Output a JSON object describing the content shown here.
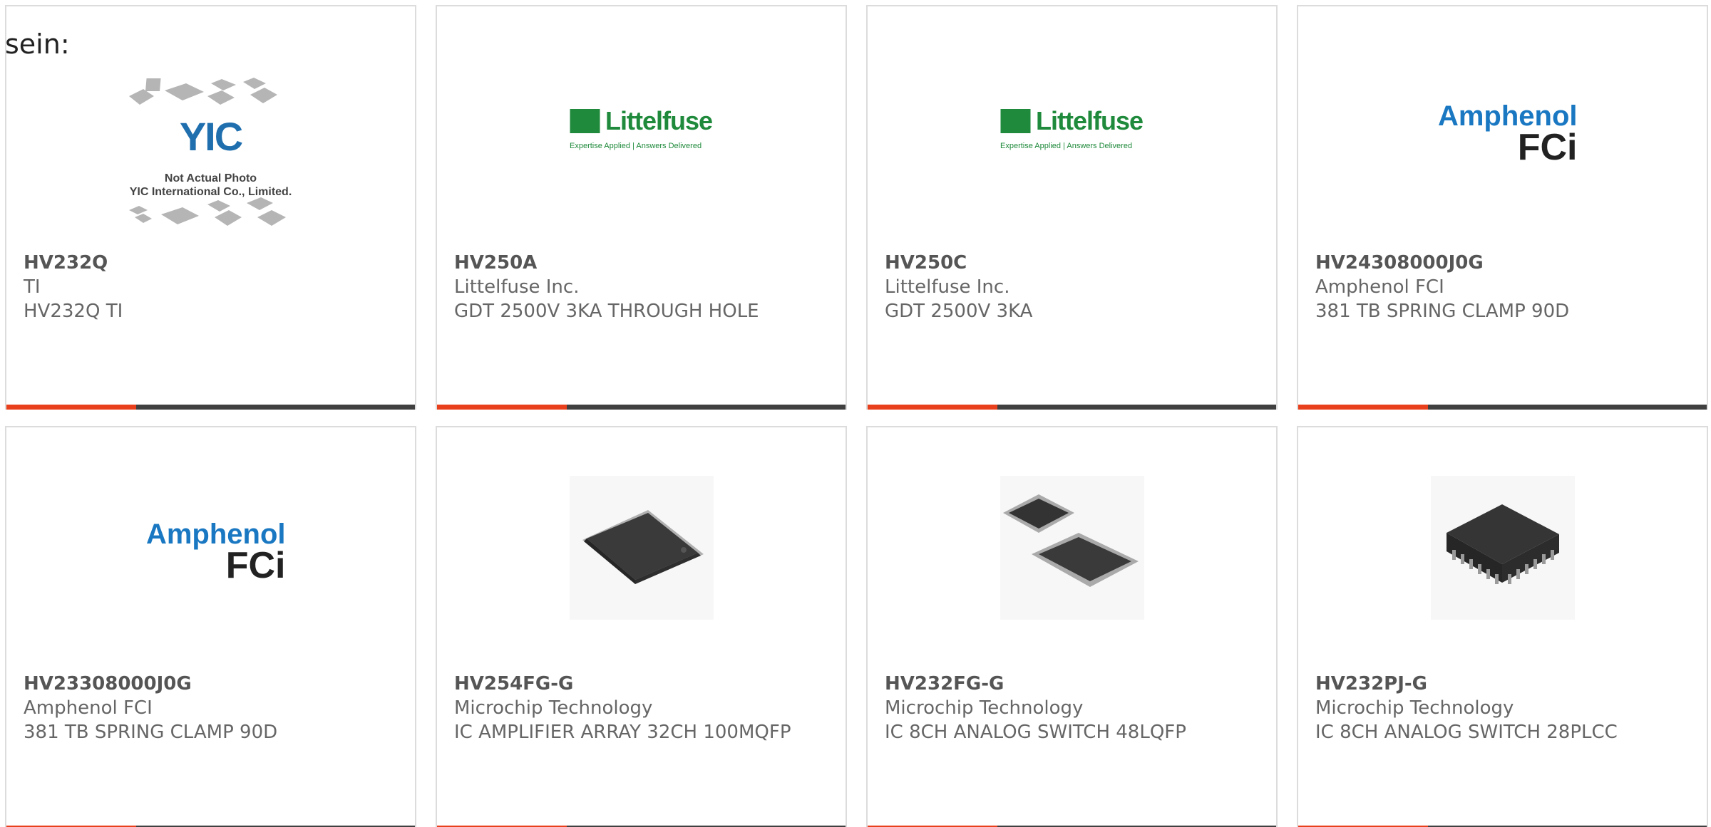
{
  "heading": "sein:",
  "theme": {
    "accent": "#e8401c",
    "bar": "#404040",
    "border": "#dcdcdc"
  },
  "cards": [
    {
      "part_number": "HV232Q",
      "manufacturer": "TI",
      "description": "HV232Q TI",
      "image": "yic-placeholder",
      "image_text": {
        "logo": "YIC",
        "note": "Not Actual Photo\nYIC International Co., Limited."
      }
    },
    {
      "part_number": "HV250A",
      "manufacturer": "Littelfuse Inc.",
      "description": "GDT 2500V 3KA THROUGH HOLE",
      "image": "littelfuse-logo",
      "image_text": {
        "brand": "Littelfuse",
        "tagline": "Expertise Applied | Answers Delivered"
      }
    },
    {
      "part_number": "HV250C",
      "manufacturer": "Littelfuse Inc.",
      "description": "GDT 2500V 3KA",
      "image": "littelfuse-logo",
      "image_text": {
        "brand": "Littelfuse",
        "tagline": "Expertise Applied | Answers Delivered"
      }
    },
    {
      "part_number": "HV24308000J0G",
      "manufacturer": "Amphenol FCI",
      "description": "381 TB SPRING CLAMP 90D",
      "image": "amphenol-fci-logo",
      "image_text": {
        "brand": "Amphenol",
        "sub": "FCi"
      }
    },
    {
      "part_number": "HV23308000J0G",
      "manufacturer": "Amphenol FCI",
      "description": "381 TB SPRING CLAMP 90D",
      "image": "amphenol-fci-logo",
      "image_text": {
        "brand": "Amphenol",
        "sub": "FCi"
      }
    },
    {
      "part_number": "HV254FG-G",
      "manufacturer": "Microchip Technology",
      "description": "IC AMPLIFIER ARRAY 32CH 100MQFP",
      "image": "mqfp-chip-photo"
    },
    {
      "part_number": "HV232FG-G",
      "manufacturer": "Microchip Technology",
      "description": "IC 8CH ANALOG SWITCH 48LQFP",
      "image": "lqfp-chip-photo"
    },
    {
      "part_number": "HV232PJ-G",
      "manufacturer": "Microchip Technology",
      "description": "IC 8CH ANALOG SWITCH 28PLCC",
      "image": "plcc-chip-photo"
    }
  ]
}
